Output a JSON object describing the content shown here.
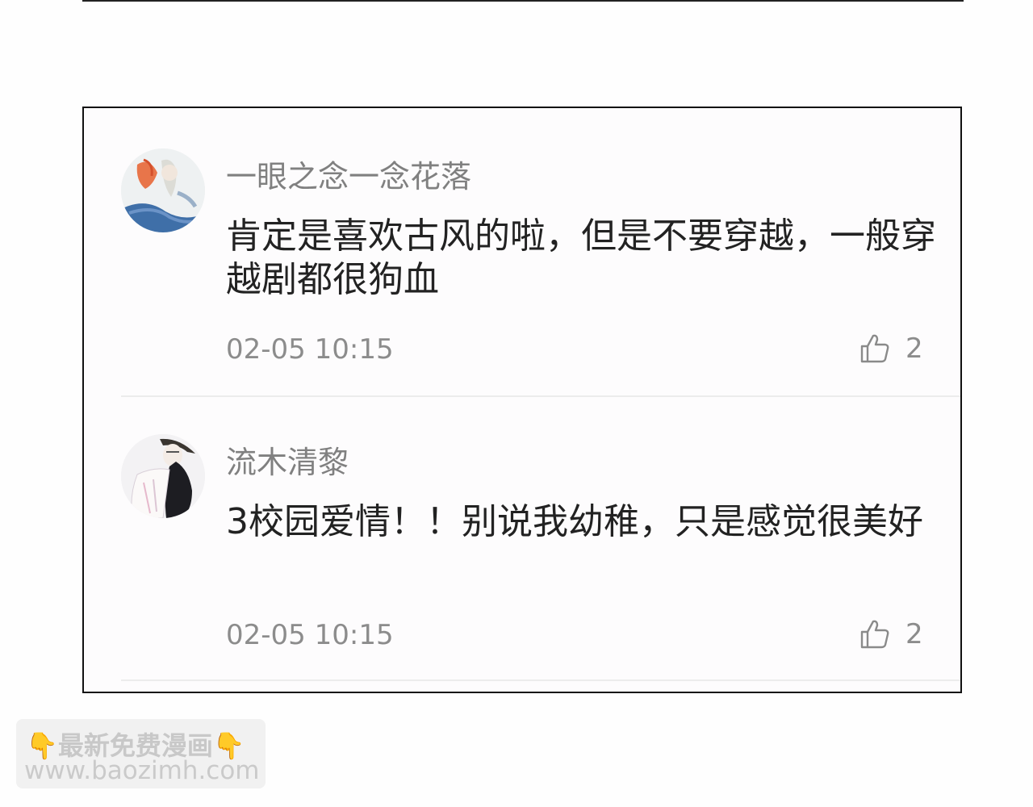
{
  "comments": [
    {
      "username": "一眼之念一念花落",
      "text": "肯定是喜欢古风的啦，但是不要穿越，一般穿越剧都很狗血",
      "timestamp": "02-05 10:15",
      "likes": "2",
      "avatar_icon": "painted-girl-avatar"
    },
    {
      "username": "流木清黎",
      "text": "3校园爱情！！别说我幼稚，只是感觉很美好",
      "timestamp": "02-05 10:15",
      "likes": "2",
      "avatar_icon": "sketch-boy-avatar"
    }
  ],
  "watermark": {
    "line1": "👇最新免费漫画👇",
    "line2": "www.baozimh.com"
  },
  "colors": {
    "username": "#808080",
    "text": "#222222",
    "meta": "#8c8c8c",
    "panel_border": "#111111"
  }
}
